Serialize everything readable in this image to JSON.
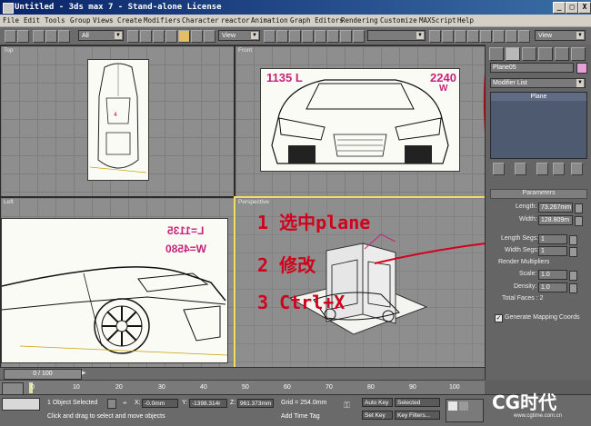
{
  "window": {
    "title": "Untitled - 3ds max 7  - Stand-alone License",
    "minimize": "_",
    "maximize": "□",
    "close": "X"
  },
  "menu": [
    "File",
    "Edit",
    "Tools",
    "Group",
    "Views",
    "Create",
    "Modifiers",
    "Character",
    "reactor",
    "Animation",
    "Graph Editors",
    "Rendering",
    "Customize",
    "MAXScript",
    "Help"
  ],
  "toolbar": {
    "selection_filter": "All",
    "ref_coord_1": "View",
    "ref_coord_2": "View"
  },
  "viewports": {
    "top": "Top",
    "front": "Front",
    "left": "Left",
    "perspective": "Perspective",
    "front_blueprint_length": "1135 L",
    "front_blueprint_width": "2240",
    "front_blueprint_w": "W",
    "left_blueprint_length": "L=1135",
    "left_blueprint_width": "W=4580"
  },
  "annotations": {
    "step1": "1  选中plane",
    "step2": "2  修改",
    "step3": "3  Ctrl+X"
  },
  "command_panel": {
    "object_name": "Plane05",
    "modifier_list": "Modifier List",
    "stack_item": "Plane",
    "parameters_header": "Parameters",
    "length_label": "Length:",
    "length_value": "73.267mm",
    "width_label": "Width:",
    "width_value": "128.809m",
    "length_segs_label": "Length Segs:",
    "length_segs_value": "1",
    "width_segs_label": "Width Segs:",
    "width_segs_value": "1",
    "render_multipliers": "Render Multipliers",
    "scale_label": "Scale:",
    "scale_value": "1.0",
    "density_label": "Density:",
    "density_value": "1.0",
    "total_faces": "Total Faces : 2",
    "generate_mapping": "Generate Mapping Coords"
  },
  "timeline": {
    "frame": "0 / 100",
    "ticks": [
      "0",
      "10",
      "20",
      "30",
      "40",
      "50",
      "60",
      "70",
      "80",
      "90",
      "100"
    ]
  },
  "status": {
    "selection": "1 Object Selected",
    "prompt": "Click and drag to select and move objects",
    "x_label": "X:",
    "x_value": "-0.0mm",
    "y_label": "Y:",
    "y_value": "-1398.314r",
    "z_label": "Z:",
    "z_value": "961.373mm",
    "grid": "Grid = 254.0mm",
    "add_time_tag": "Add Time Tag",
    "auto_key": "Auto Key",
    "set_key": "Set Key",
    "selected": "Selected",
    "key_filters": "Key Filters..."
  },
  "watermark": {
    "logo": "CG时代",
    "url": "www.cgtime.com.cn"
  },
  "colors": {
    "annotation_red": "#d0021b",
    "active_viewport": "#f0e060",
    "object_color_swatch": "#e8a0d8"
  }
}
